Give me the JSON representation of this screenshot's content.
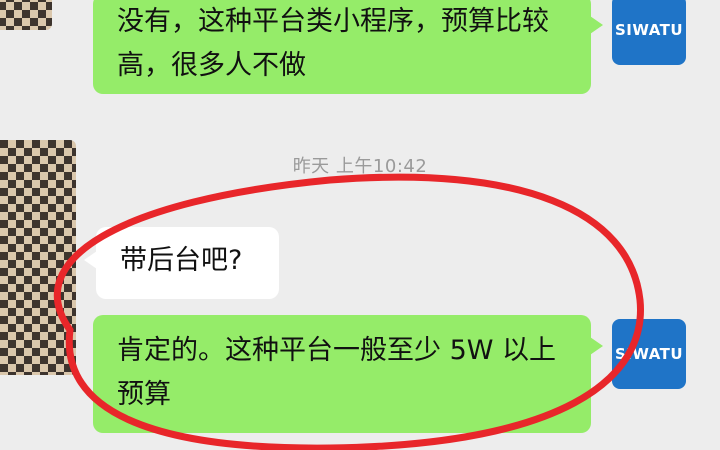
{
  "chat": {
    "messages": [
      {
        "sender": "self",
        "text": "没有，这种平台类小程序，预算比较高，很多人不做"
      },
      {
        "sender": "other",
        "text": "带后台吧?"
      },
      {
        "sender": "self",
        "text": "肯定的。这种平台一般至少 5W 以上预算"
      }
    ],
    "timestamp": "昨天 上午10:42"
  },
  "avatars": {
    "self_label": "SIWATU",
    "self_color": "#1f74c7"
  },
  "colors": {
    "background": "#ededed",
    "self_bubble": "#95ec69",
    "other_bubble": "#ffffff",
    "annotation": "#e8262a"
  },
  "annotation": {
    "shape": "circle-highlight"
  }
}
